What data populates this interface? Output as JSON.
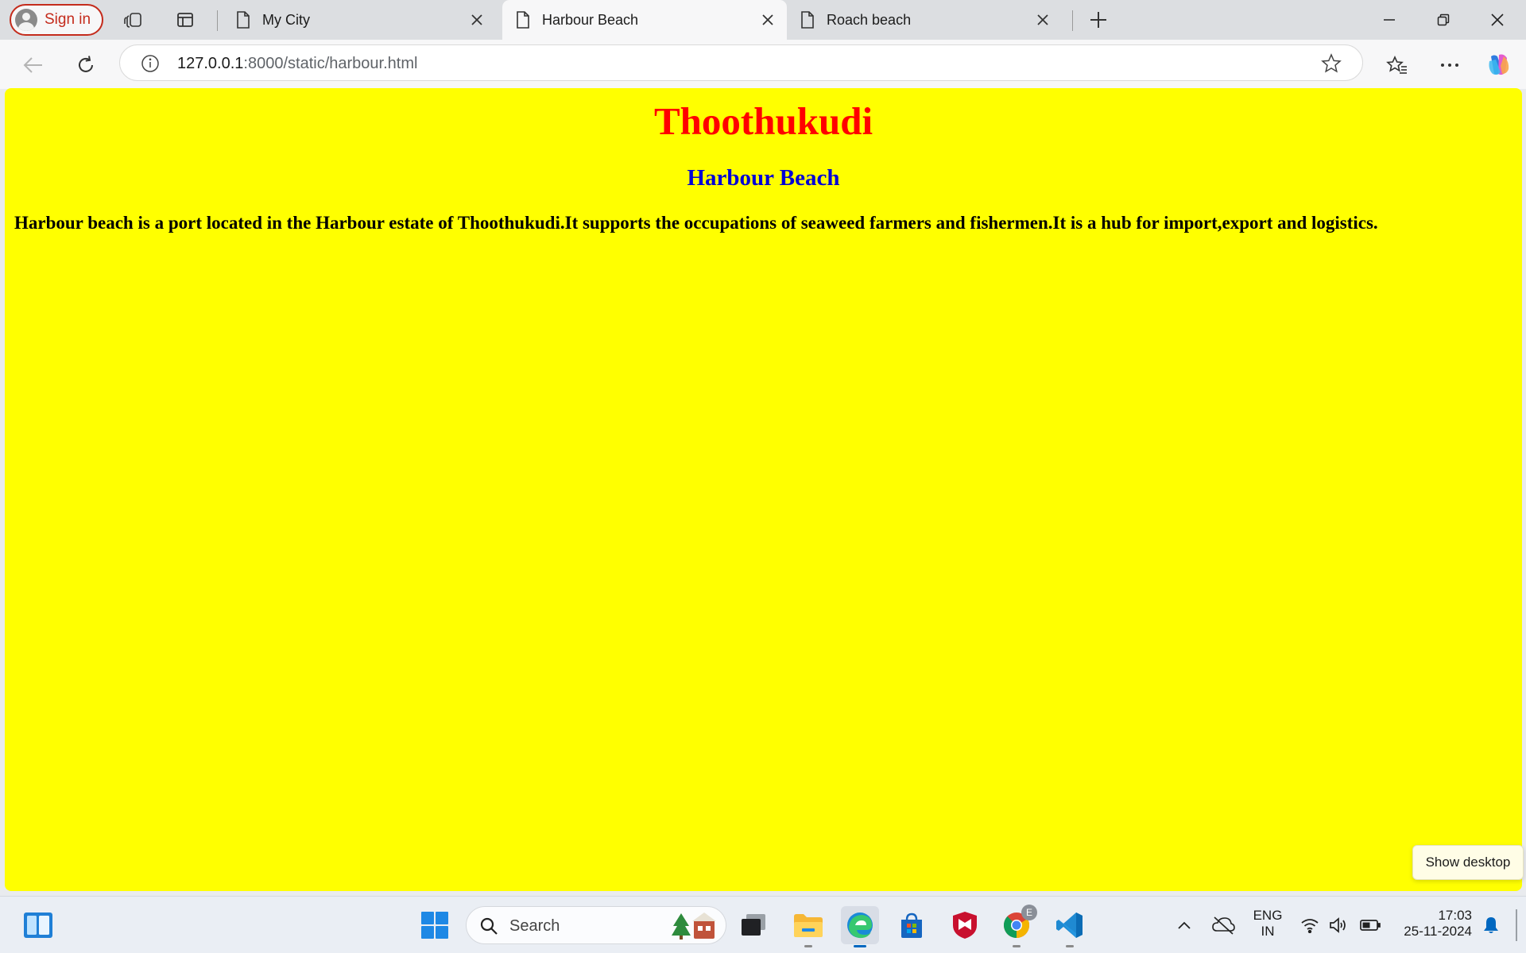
{
  "browser": {
    "sign_in_label": "Sign in",
    "tabs": [
      {
        "title": "My City",
        "active": false
      },
      {
        "title": "Harbour Beach",
        "active": true
      },
      {
        "title": "Roach beach",
        "active": false
      }
    ],
    "url_host": "127.0.0.1",
    "url_rest": ":8000/static/harbour.html"
  },
  "page": {
    "background_color": "#ffff00",
    "title": "Thoothukudi",
    "title_color": "#ff0000",
    "subtitle": "Harbour Beach",
    "subtitle_color": "#0000d6",
    "paragraph": "Harbour beach is a port located in the Harbour estate of Thoothukudi.It supports the occupations of seaweed farmers and fishermen.It is a hub for import,export and logistics."
  },
  "tooltip": {
    "label": "Show desktop"
  },
  "taskbar": {
    "search_placeholder": "Search",
    "language": "ENG",
    "region": "IN",
    "time": "17:03",
    "date": "25-11-2024",
    "chrome_badge": "E",
    "accent_color": "#0067c0"
  }
}
